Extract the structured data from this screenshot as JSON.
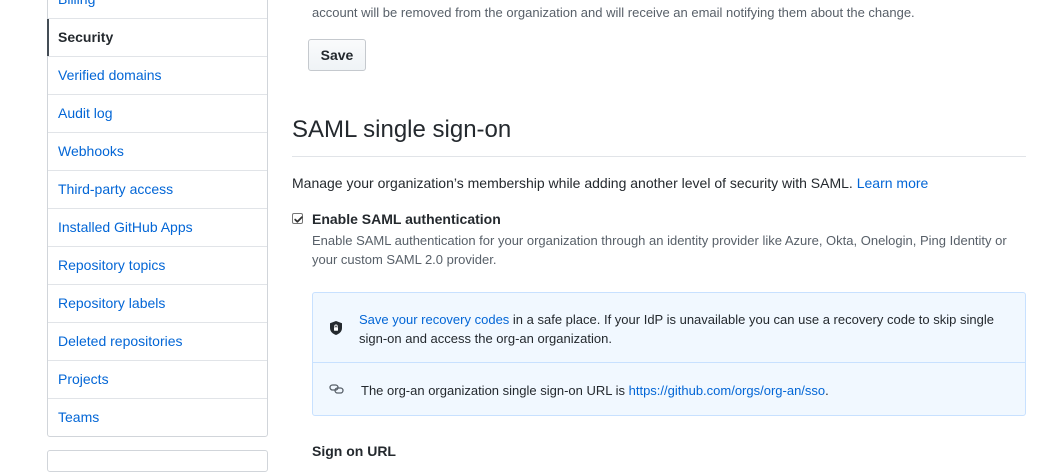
{
  "sidebar": {
    "items": [
      {
        "label": "Billing",
        "selected": false
      },
      {
        "label": "Security",
        "selected": true
      },
      {
        "label": "Verified domains",
        "selected": false
      },
      {
        "label": "Audit log",
        "selected": false
      },
      {
        "label": "Webhooks",
        "selected": false
      },
      {
        "label": "Third-party access",
        "selected": false
      },
      {
        "label": "Installed GitHub Apps",
        "selected": false
      },
      {
        "label": "Repository topics",
        "selected": false
      },
      {
        "label": "Repository labels",
        "selected": false
      },
      {
        "label": "Deleted repositories",
        "selected": false
      },
      {
        "label": "Projects",
        "selected": false
      },
      {
        "label": "Teams",
        "selected": false
      }
    ]
  },
  "main": {
    "top_note": "account will be removed from the organization and will receive an email notifying them about the change.",
    "save_label": "Save",
    "saml": {
      "title": "SAML single sign-on",
      "intro": "Manage your organization’s membership while adding another level of security with SAML.",
      "learn_more": "Learn more",
      "enable_label": "Enable SAML authentication",
      "enable_checked": true,
      "enable_desc": "Enable SAML authentication for your organization through an identity provider like Azure, Okta, Onelogin, Ping Identity or your custom SAML 2.0 provider.",
      "recovery_link": "Save your recovery codes",
      "recovery_text": " in a safe place. If your IdP is unavailable you can use a recovery code to skip single sign-on and access the org-an organization.",
      "sso_prefix": "The org-an organization single sign-on URL is ",
      "sso_url": "https://github.com/orgs/org-an/sso",
      "sso_suffix": ".",
      "sign_on_url_heading": "Sign on URL"
    }
  },
  "colors": {
    "link": "#0366d6",
    "text": "#24292e",
    "muted": "#586069",
    "info_bg": "#f1f8ff",
    "info_border": "#c8e1ff"
  },
  "icons": {
    "shield": "shield-lock-icon",
    "link": "link-icon",
    "check": "check-icon"
  }
}
